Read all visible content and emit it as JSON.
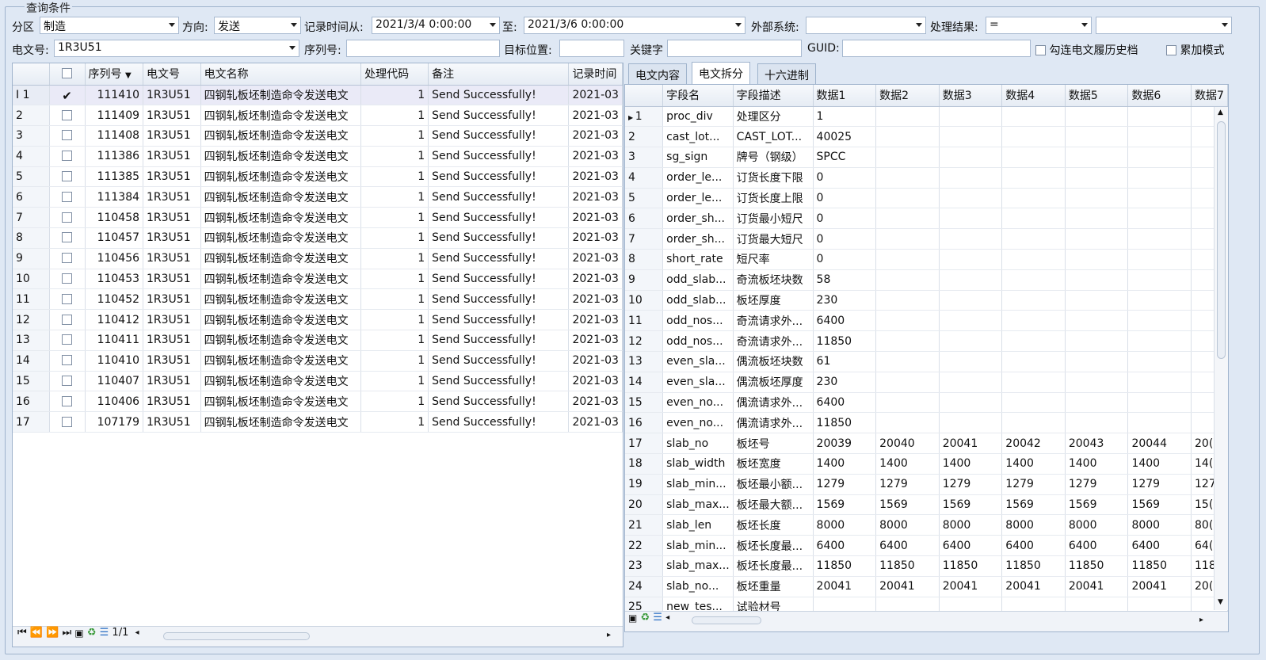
{
  "group_title": "查询条件",
  "filters": {
    "area_label": "分区",
    "area_value": "制造",
    "direction_label": "方向:",
    "direction_value": "发送",
    "time_from_label": "记录时间从:",
    "time_from_value": "2021/3/4 0:00:00",
    "time_to_label": "至:",
    "time_to_value": "2021/3/6 0:00:00",
    "external_label": "外部系统:",
    "external_value": "",
    "result_label": "处理结果:",
    "result_op": "=",
    "result_value": "",
    "msgno_label": "电文号:",
    "msgno_value": "1R3U51",
    "seq_label": "序列号:",
    "seq_value": "",
    "target_label": "目标位置:",
    "target_value": "",
    "keyword_label": "关键字",
    "keyword_value": "",
    "guid_label": "GUID:",
    "guid_value": "",
    "history_label": "勾连电文履历史档",
    "accumulate_label": "累加模式"
  },
  "left_grid": {
    "columns": [
      "",
      "序列号",
      "电文号",
      "电文名称",
      "处理代码",
      "备注",
      "记录时间"
    ],
    "rows": [
      {
        "rn": "I 1",
        "checked": true,
        "seq": "111410",
        "msg": "1R3U51",
        "name": "四钢轧板坯制造命令发送电文",
        "code": "1",
        "note": "Send Successfully!",
        "time": "2021-03"
      },
      {
        "rn": "2",
        "checked": false,
        "seq": "111409",
        "msg": "1R3U51",
        "name": "四钢轧板坯制造命令发送电文",
        "code": "1",
        "note": "Send Successfully!",
        "time": "2021-03"
      },
      {
        "rn": "3",
        "checked": false,
        "seq": "111408",
        "msg": "1R3U51",
        "name": "四钢轧板坯制造命令发送电文",
        "code": "1",
        "note": "Send Successfully!",
        "time": "2021-03"
      },
      {
        "rn": "4",
        "checked": false,
        "seq": "111386",
        "msg": "1R3U51",
        "name": "四钢轧板坯制造命令发送电文",
        "code": "1",
        "note": "Send Successfully!",
        "time": "2021-03"
      },
      {
        "rn": "5",
        "checked": false,
        "seq": "111385",
        "msg": "1R3U51",
        "name": "四钢轧板坯制造命令发送电文",
        "code": "1",
        "note": "Send Successfully!",
        "time": "2021-03"
      },
      {
        "rn": "6",
        "checked": false,
        "seq": "111384",
        "msg": "1R3U51",
        "name": "四钢轧板坯制造命令发送电文",
        "code": "1",
        "note": "Send Successfully!",
        "time": "2021-03"
      },
      {
        "rn": "7",
        "checked": false,
        "seq": "110458",
        "msg": "1R3U51",
        "name": "四钢轧板坯制造命令发送电文",
        "code": "1",
        "note": "Send Successfully!",
        "time": "2021-03"
      },
      {
        "rn": "8",
        "checked": false,
        "seq": "110457",
        "msg": "1R3U51",
        "name": "四钢轧板坯制造命令发送电文",
        "code": "1",
        "note": "Send Successfully!",
        "time": "2021-03"
      },
      {
        "rn": "9",
        "checked": false,
        "seq": "110456",
        "msg": "1R3U51",
        "name": "四钢轧板坯制造命令发送电文",
        "code": "1",
        "note": "Send Successfully!",
        "time": "2021-03"
      },
      {
        "rn": "10",
        "checked": false,
        "seq": "110453",
        "msg": "1R3U51",
        "name": "四钢轧板坯制造命令发送电文",
        "code": "1",
        "note": "Send Successfully!",
        "time": "2021-03"
      },
      {
        "rn": "11",
        "checked": false,
        "seq": "110452",
        "msg": "1R3U51",
        "name": "四钢轧板坯制造命令发送电文",
        "code": "1",
        "note": "Send Successfully!",
        "time": "2021-03"
      },
      {
        "rn": "12",
        "checked": false,
        "seq": "110412",
        "msg": "1R3U51",
        "name": "四钢轧板坯制造命令发送电文",
        "code": "1",
        "note": "Send Successfully!",
        "time": "2021-03"
      },
      {
        "rn": "13",
        "checked": false,
        "seq": "110411",
        "msg": "1R3U51",
        "name": "四钢轧板坯制造命令发送电文",
        "code": "1",
        "note": "Send Successfully!",
        "time": "2021-03"
      },
      {
        "rn": "14",
        "checked": false,
        "seq": "110410",
        "msg": "1R3U51",
        "name": "四钢轧板坯制造命令发送电文",
        "code": "1",
        "note": "Send Successfully!",
        "time": "2021-03"
      },
      {
        "rn": "15",
        "checked": false,
        "seq": "110407",
        "msg": "1R3U51",
        "name": "四钢轧板坯制造命令发送电文",
        "code": "1",
        "note": "Send Successfully!",
        "time": "2021-03"
      },
      {
        "rn": "16",
        "checked": false,
        "seq": "110406",
        "msg": "1R3U51",
        "name": "四钢轧板坯制造命令发送电文",
        "code": "1",
        "note": "Send Successfully!",
        "time": "2021-03"
      },
      {
        "rn": "17",
        "checked": false,
        "seq": "107179",
        "msg": "1R3U51",
        "name": "四钢轧板坯制造命令发送电文",
        "code": "1",
        "note": "Send Successfully!",
        "time": "2021-03"
      }
    ],
    "pager": "1/1"
  },
  "tabs": [
    "电文内容",
    "电文拆分",
    "十六进制"
  ],
  "active_tab": 1,
  "right_grid": {
    "columns": [
      "",
      "字段名",
      "字段描述",
      "数据1",
      "数据2",
      "数据3",
      "数据4",
      "数据5",
      "数据6",
      "数据7"
    ],
    "rows": [
      [
        "1",
        "proc_div",
        "处理区分",
        "1",
        "",
        "",
        "",
        "",
        "",
        ""
      ],
      [
        "2",
        "cast_lot...",
        "CAST_LOT...",
        "40025",
        "",
        "",
        "",
        "",
        "",
        ""
      ],
      [
        "3",
        "sg_sign",
        "牌号（钢级）",
        "SPCC",
        "",
        "",
        "",
        "",
        "",
        ""
      ],
      [
        "4",
        "order_le...",
        "订货长度下限",
        "0",
        "",
        "",
        "",
        "",
        "",
        ""
      ],
      [
        "5",
        "order_le...",
        "订货长度上限",
        "0",
        "",
        "",
        "",
        "",
        "",
        ""
      ],
      [
        "6",
        "order_sh...",
        "订货最小短尺",
        "0",
        "",
        "",
        "",
        "",
        "",
        ""
      ],
      [
        "7",
        "order_sh...",
        "订货最大短尺",
        "0",
        "",
        "",
        "",
        "",
        "",
        ""
      ],
      [
        "8",
        "short_rate",
        "短尺率",
        "0",
        "",
        "",
        "",
        "",
        "",
        ""
      ],
      [
        "9",
        "odd_slab...",
        "奇流板坯块数",
        "58",
        "",
        "",
        "",
        "",
        "",
        ""
      ],
      [
        "10",
        "odd_slab...",
        "板坯厚度",
        "230",
        "",
        "",
        "",
        "",
        "",
        ""
      ],
      [
        "11",
        "odd_nos...",
        "奇流请求外...",
        "6400",
        "",
        "",
        "",
        "",
        "",
        ""
      ],
      [
        "12",
        "odd_nos...",
        "奇流请求外...",
        "11850",
        "",
        "",
        "",
        "",
        "",
        ""
      ],
      [
        "13",
        "even_sla...",
        "偶流板坯块数",
        "61",
        "",
        "",
        "",
        "",
        "",
        ""
      ],
      [
        "14",
        "even_sla...",
        "偶流板坯厚度",
        "230",
        "",
        "",
        "",
        "",
        "",
        ""
      ],
      [
        "15",
        "even_no...",
        "偶流请求外...",
        "6400",
        "",
        "",
        "",
        "",
        "",
        ""
      ],
      [
        "16",
        "even_no...",
        "偶流请求外...",
        "11850",
        "",
        "",
        "",
        "",
        "",
        ""
      ],
      [
        "17",
        "slab_no",
        "板坯号",
        "20039",
        "20040",
        "20041",
        "20042",
        "20043",
        "20044",
        "20("
      ],
      [
        "18",
        "slab_width",
        "板坯宽度",
        "1400",
        "1400",
        "1400",
        "1400",
        "1400",
        "1400",
        "14("
      ],
      [
        "19",
        "slab_min...",
        "板坯最小额...",
        "1279",
        "1279",
        "1279",
        "1279",
        "1279",
        "1279",
        "127"
      ],
      [
        "20",
        "slab_max...",
        "板坯最大额...",
        "1569",
        "1569",
        "1569",
        "1569",
        "1569",
        "1569",
        "15("
      ],
      [
        "21",
        "slab_len",
        "板坯长度",
        "8000",
        "8000",
        "8000",
        "8000",
        "8000",
        "8000",
        "80("
      ],
      [
        "22",
        "slab_min...",
        "板坯长度最...",
        "6400",
        "6400",
        "6400",
        "6400",
        "6400",
        "6400",
        "64("
      ],
      [
        "23",
        "slab_max...",
        "板坯长度最...",
        "11850",
        "11850",
        "11850",
        "11850",
        "11850",
        "11850",
        "118"
      ],
      [
        "24",
        "slab_no...",
        "板坯重量",
        "20041",
        "20041",
        "20041",
        "20041",
        "20041",
        "20041",
        "20("
      ],
      [
        "25",
        "new_tes...",
        "试验材号",
        "",
        "",
        "",
        "",
        "",
        "",
        ""
      ]
    ]
  },
  "colors": {
    "background": "#dfe8f4",
    "border": "#9fb3cc",
    "selected_row": "#eaeaf7"
  }
}
